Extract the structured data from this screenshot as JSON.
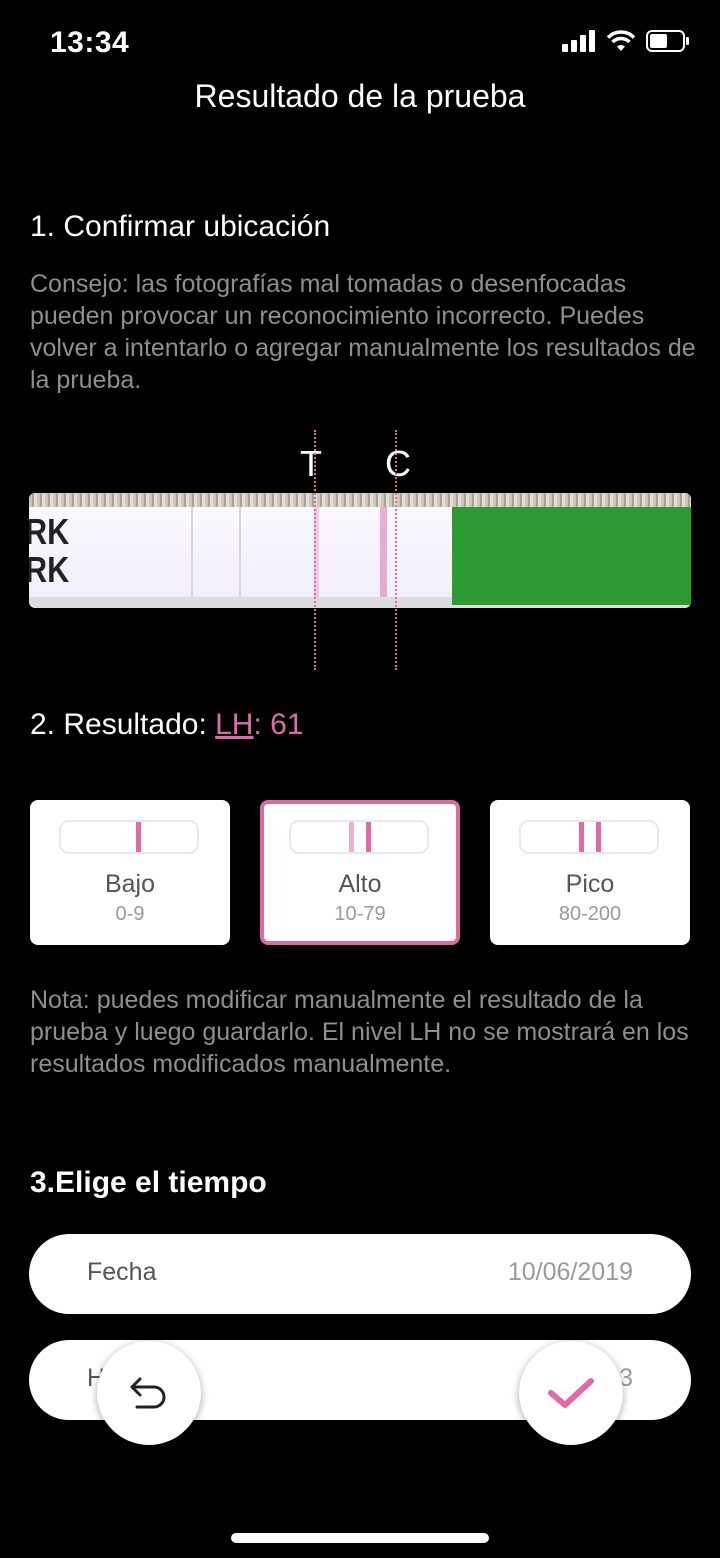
{
  "status_bar": {
    "time": "13:34"
  },
  "header": {
    "title": "Resultado de la prueba"
  },
  "section1": {
    "title": "1. Confirmar ubicación",
    "tip": "Consejo: las fotografías mal tomadas o desenfocadas pueden provocar un reconocimiento incorrecto. Puedes volver a intentarlo o agregar manualmente los resultados de la prueba.",
    "marker_t": "T",
    "marker_c": "C",
    "strip_text": "RK\nRK"
  },
  "section2": {
    "title_prefix": "2. Resultado: ",
    "lh_label": "LH",
    "lh_value": ": 61",
    "options": [
      {
        "label": "Bajo",
        "range": "0-9"
      },
      {
        "label": "Alto",
        "range": "10-79"
      },
      {
        "label": "Pico",
        "range": "80-200"
      }
    ],
    "note": "Nota: puedes modificar manualmente el resultado de la prueba y luego guardarlo. El nivel LH no se mostrará en los resultados modificados manualmente."
  },
  "section3": {
    "title": "3.Elige el tiempo",
    "date_label": "Fecha",
    "date_value": "10/06/2019",
    "hour_label": "H",
    "hour_value": "3"
  },
  "colors": {
    "accent": "#e06aa8",
    "background": "#000000"
  },
  "icons": {
    "back": "undo-arrow-icon",
    "confirm": "checkmark-icon"
  }
}
